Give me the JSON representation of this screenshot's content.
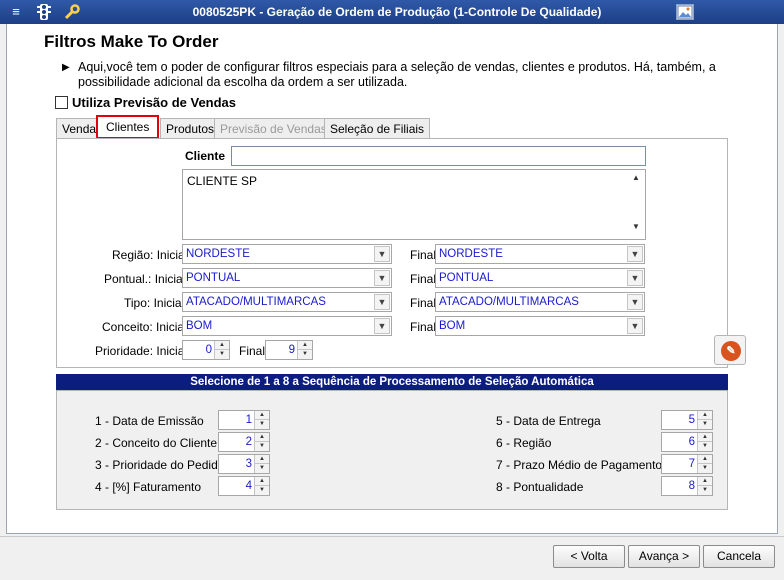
{
  "window": {
    "title": "0080525PK - Geração de Ordem de Produção (1-Controle De Qualidade)"
  },
  "page": {
    "heading": "Filtros Make To Order",
    "description": "Aqui,você tem o poder de configurar filtros especiais para a seleção de vendas, clientes e produtos. Há, também, a possibilidade adicional da escolha da ordem a ser utilizada.",
    "use_forecast_label": "Utiliza Previsão de Vendas"
  },
  "tabs": [
    {
      "label": "Vendas"
    },
    {
      "label": "Clientes"
    },
    {
      "label": "Produtos"
    },
    {
      "label": "Previsão de Vendas"
    },
    {
      "label": "Seleção de Filiais"
    }
  ],
  "clientes": {
    "cliente_label": "Cliente",
    "cliente_value": "",
    "list_items": [
      "CLIENTE SP"
    ],
    "regiao_label": "Região: Inicial",
    "regiao_inicial": "NORDESTE",
    "regiao_final": "NORDESTE",
    "pontual_label": "Pontual.: Inicial",
    "pontual_inicial": "PONTUAL",
    "pontual_final": "PONTUAL",
    "tipo_label": "Tipo: Inicial",
    "tipo_inicial": "ATACADO/MULTIMARCAS",
    "tipo_final": "ATACADO/MULTIMARCAS",
    "conceito_label": "Conceito: Inicial",
    "conceito_inicial": "BOM",
    "conceito_final": "BOM",
    "final_label": "Final",
    "prioridade_label": "Prioridade: Inicial",
    "prioridade_inicial": "0",
    "prioridade_final_label": "Final",
    "prioridade_final": "9"
  },
  "sequence": {
    "title": "Selecione de 1 a 8 a Sequência de Processamento de Seleção Automática",
    "left": [
      {
        "label": "1 - Data de Emissão",
        "value": "1"
      },
      {
        "label": "2 - Conceito do Cliente",
        "value": "2"
      },
      {
        "label": "3 - Prioridade do Pedido",
        "value": "3"
      },
      {
        "label": "4 - [%] Faturamento",
        "value": "4"
      }
    ],
    "right": [
      {
        "label": "5 - Data de Entrega",
        "value": "5"
      },
      {
        "label": "6 - Região",
        "value": "6"
      },
      {
        "label": "7 - Prazo Médio de Pagamento",
        "value": "7"
      },
      {
        "label": "8 - Pontualidade",
        "value": "8"
      }
    ]
  },
  "footer": {
    "back": "< Volta",
    "next": "Avança >",
    "cancel": "Cancela"
  },
  "colors": {
    "titlebar": "#1d3f85",
    "value_text": "#1a1acc",
    "seq_header": "#0b1e80",
    "active_tab_border": "#e3000f"
  },
  "icons": [
    "menu-icon",
    "traffic-light-icon",
    "wrench-icon",
    "image-icon",
    "eraser-icon"
  ]
}
